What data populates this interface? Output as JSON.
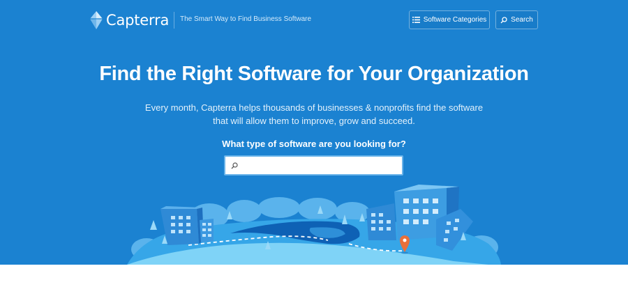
{
  "header": {
    "logo_text": "Capterra",
    "tagline": "The Smart Way to Find Business Software",
    "nav": {
      "categories_label": "Software Categories",
      "categories_icon": "list-icon",
      "search_label": "Search",
      "search_icon": "search-icon"
    }
  },
  "hero": {
    "title": "Find the Right Software for Your Organization",
    "subtitle_line1": "Every month, Capterra helps thousands of businesses & nonprofits find the software",
    "subtitle_line2": "that will allow them to improve, grow and succeed.",
    "question": "What type of software are you looking for?",
    "search": {
      "value": "",
      "placeholder": ""
    },
    "illustration": "city-illustration"
  },
  "colors": {
    "hero_background": "#1b82d1",
    "accent_pin": "#e8703a",
    "text": "#ffffff"
  }
}
